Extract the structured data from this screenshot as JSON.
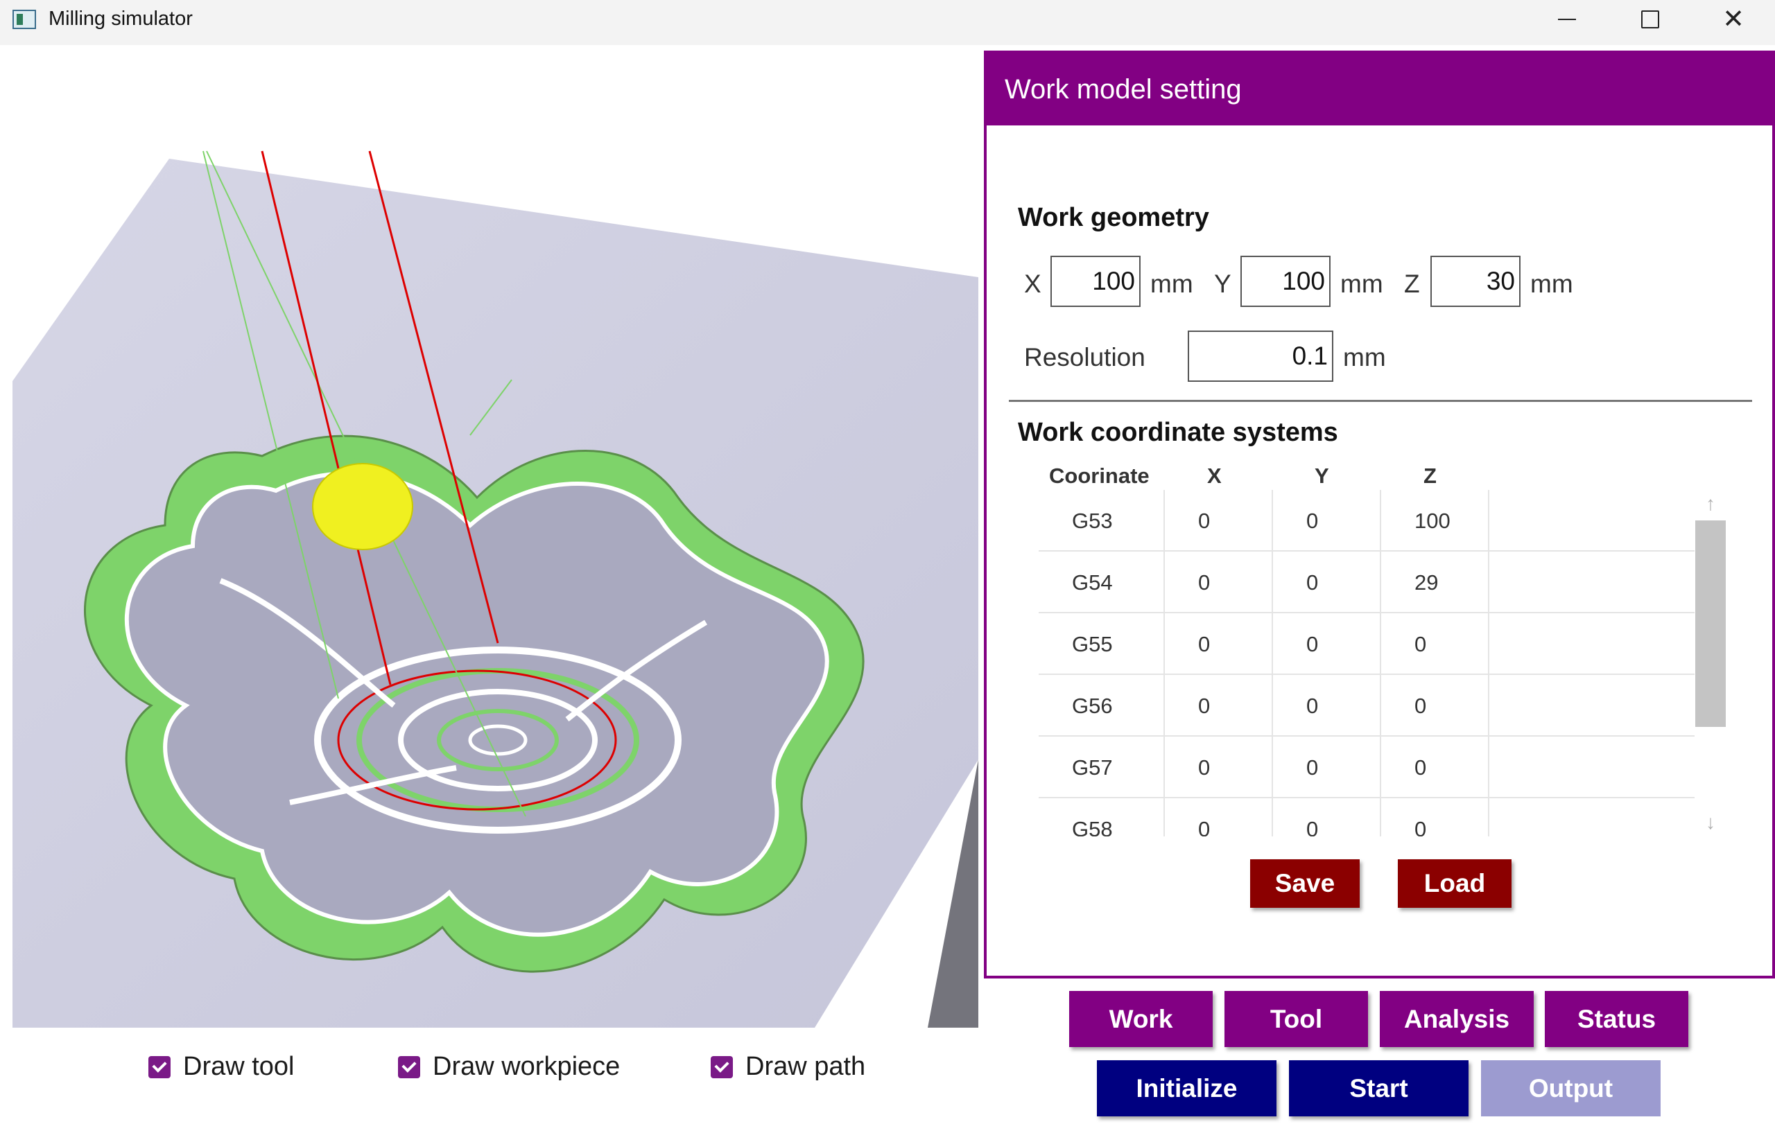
{
  "window": {
    "title": "Milling simulator",
    "icon": "app-window-icon"
  },
  "view_options": [
    {
      "label": "Draw tool",
      "checked": true
    },
    {
      "label": "Draw workpiece",
      "checked": true
    },
    {
      "label": "Draw path",
      "checked": true
    }
  ],
  "panel": {
    "header": "Work model setting",
    "geometry": {
      "title": "Work geometry",
      "x_label": "X",
      "x_value": "100",
      "x_unit": "mm",
      "y_label": "Y",
      "y_value": "100",
      "y_unit": "mm",
      "z_label": "Z",
      "z_value": "30",
      "z_unit": "mm",
      "resolution_label": "Resolution",
      "resolution_value": "0.1",
      "resolution_unit": "mm"
    },
    "wcs": {
      "title": "Work coordinate systems",
      "columns": [
        "Coorinate",
        "X",
        "Y",
        "Z"
      ],
      "rows": [
        [
          "G53",
          "0",
          "0",
          "100"
        ],
        [
          "G54",
          "0",
          "0",
          "29"
        ],
        [
          "G55",
          "0",
          "0",
          "0"
        ],
        [
          "G56",
          "0",
          "0",
          "0"
        ],
        [
          "G57",
          "0",
          "0",
          "0"
        ],
        [
          "G58",
          "0",
          "0",
          "0"
        ]
      ]
    },
    "save_label": "Save",
    "load_label": "Load"
  },
  "nav": {
    "work": "Work",
    "tool": "Tool",
    "analysis": "Analysis",
    "status": "Status"
  },
  "actions": {
    "initialize": "Initialize",
    "start": "Start",
    "output": "Output",
    "output_enabled": false
  },
  "colors": {
    "accent_purple": "#820083",
    "button_red": "#8b0000",
    "button_navy": "#000080",
    "button_disabled": "#9c9bd0",
    "workpiece": "#ccccdf",
    "toolpath_green": "#7ed36a",
    "tool_yellow": "#f0f020",
    "tool_axis_red": "#dd0000"
  }
}
